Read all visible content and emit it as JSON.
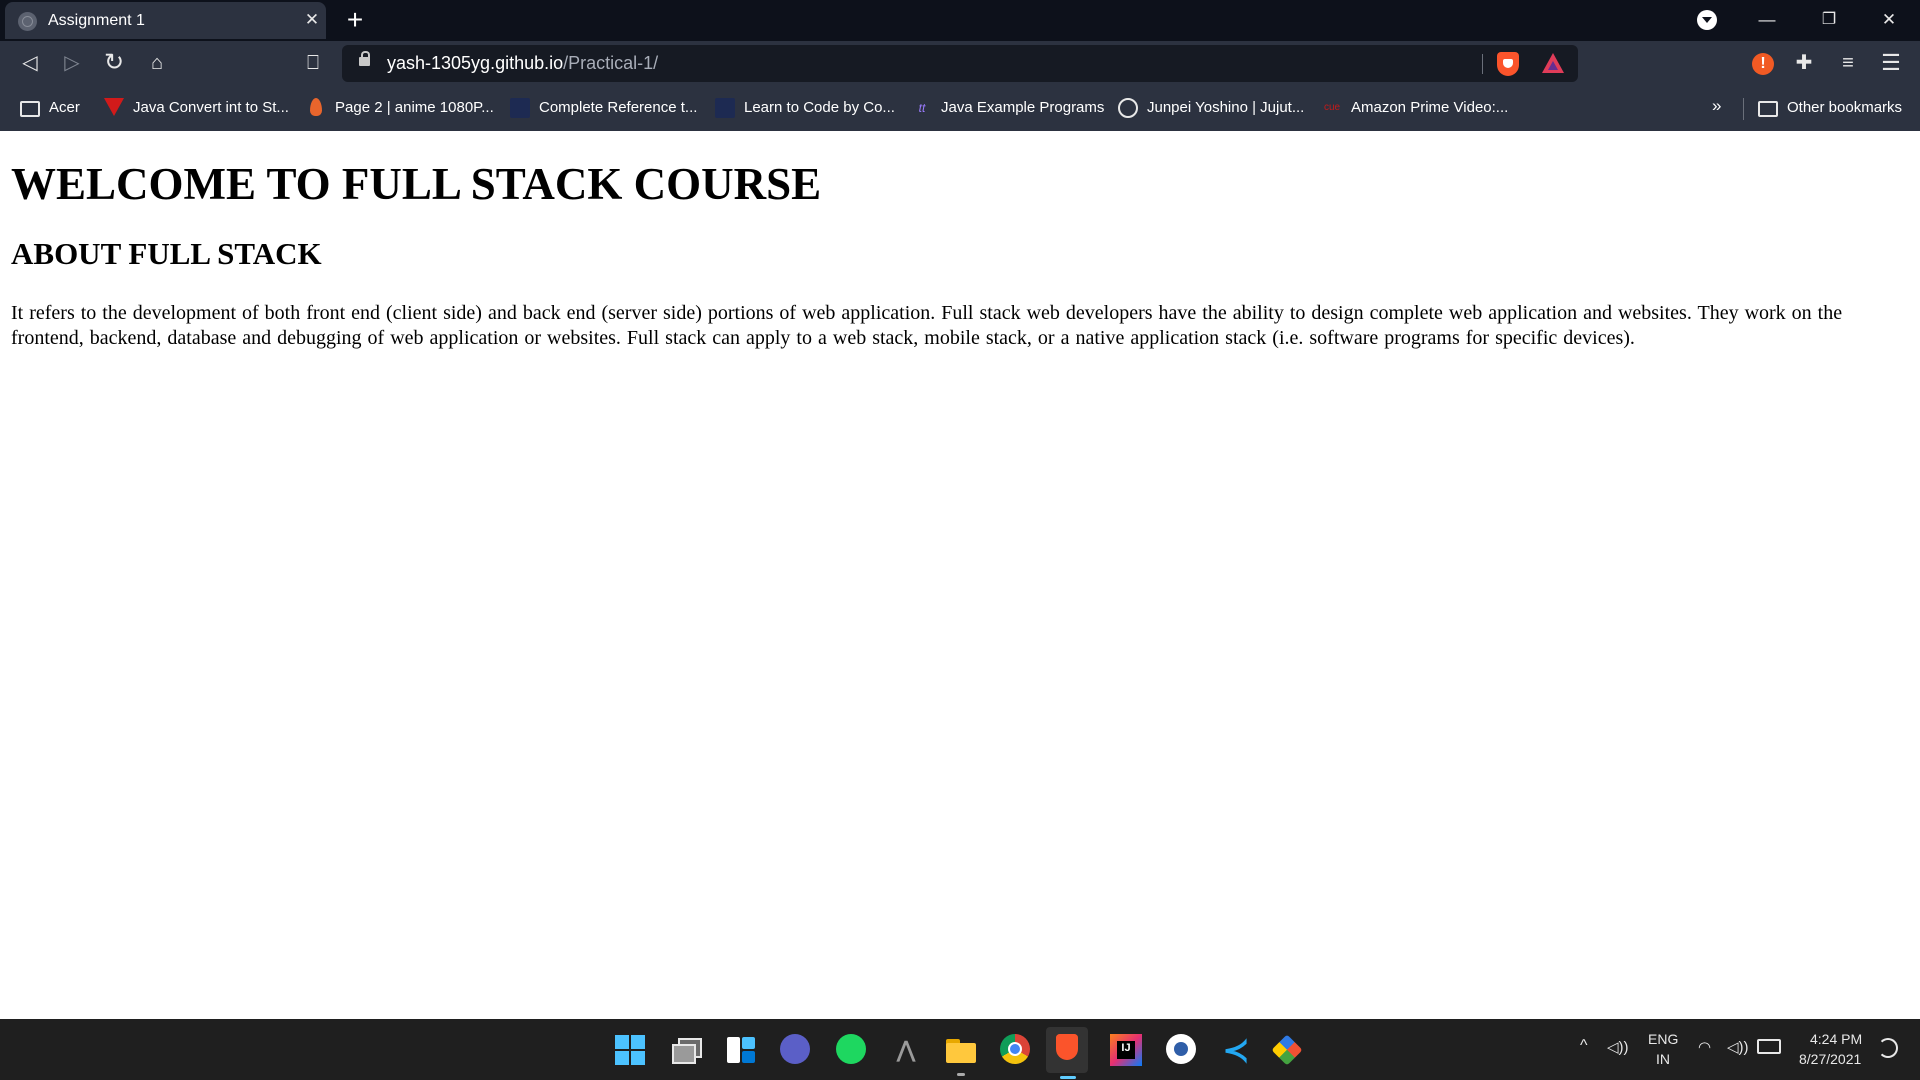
{
  "browser": {
    "tab": {
      "title": "Assignment 1",
      "close_glyph": "✕"
    },
    "new_tab_glyph": "+",
    "window_controls": {
      "minimize": "—",
      "maximize": "❐",
      "close": "✕"
    },
    "toolbar": {
      "back_glyph": "◁",
      "forward_glyph": "▷",
      "reload_glyph": "↻",
      "home_glyph": "⌂",
      "bookmark_glyph": "⎕",
      "url_host": "yash-1305yg.github.io",
      "url_path": "/Practical-1/",
      "warning_glyph": "!",
      "extensions_glyph": "✚",
      "media_glyph": "≡",
      "menu_glyph": "☰"
    },
    "bookmarks": [
      {
        "label": "Acer",
        "icon": "folder-icon"
      },
      {
        "label": "Java Convert int to St...",
        "icon": "triangle-logo-icon"
      },
      {
        "label": "Page 2 | anime 1080P...",
        "icon": "flame-icon"
      },
      {
        "label": "Complete Reference t...",
        "icon": "site-icon"
      },
      {
        "label": "Learn to Code by Co...",
        "icon": "site-icon"
      },
      {
        "label": "Java Example Programs",
        "icon": "tt-logo-icon",
        "icon_text": "tt"
      },
      {
        "label": "Junpei Yoshino | Jujut...",
        "icon": "openai-logo-icon"
      },
      {
        "label": "Amazon Prime Video:...",
        "icon": "text-logo-icon",
        "icon_text": "cue"
      }
    ],
    "bookmarks_overflow_glyph": "»",
    "other_bookmarks": {
      "label": "Other bookmarks",
      "icon": "folder-icon"
    }
  },
  "page": {
    "h1": "WELCOME TO FULL STACK COURSE",
    "h2": "ABOUT FULL STACK",
    "paragraph": "It refers to the development of both front end (client side) and back end (server side) portions of web application. Full stack web developers have the ability to design complete web application and websites. They work on the frontend, backend, database and debugging of web application or websites. Full stack can apply to a web stack, mobile stack, or a native application stack (i.e. software programs for specific devices)."
  },
  "taskbar": {
    "apps": [
      "start-icon",
      "task-view-icon",
      "widgets-icon",
      "chat-icon",
      "spotify-icon",
      "predator-sense-icon",
      "file-explorer-icon",
      "chrome-icon",
      "brave-icon",
      "intellij-idea-icon",
      "vpn-icon",
      "vscode-icon",
      "git-icon"
    ],
    "predator_glyph": "⋀",
    "vscode_glyph": "≺",
    "tray": {
      "chevron_glyph": "^",
      "speaker_glyph": "◁))",
      "lang_top": "ENG",
      "lang_bottom": "IN",
      "wifi_glyph": "◠",
      "volume_glyph": "◁))",
      "time": "4:24 PM",
      "date": "8/27/2021"
    }
  },
  "colors": {
    "tab_strip_bg": "#0d111b",
    "toolbar_bg": "#2c3240",
    "omnibox_bg": "#161a23",
    "brave_orange": "#fb542b",
    "taskbar_bg": "#1f1f1f"
  }
}
